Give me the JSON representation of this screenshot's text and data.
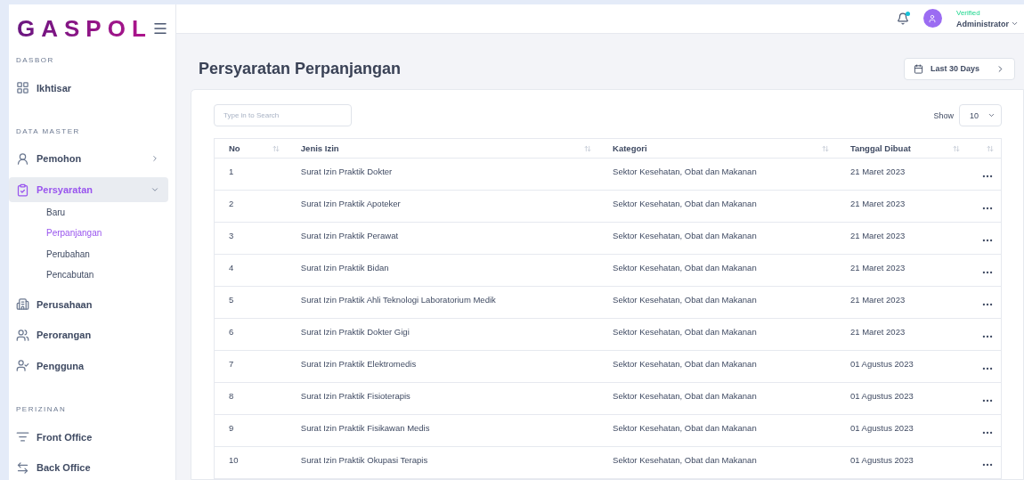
{
  "logo": "GASPOL",
  "sidebar": {
    "sections": [
      {
        "heading": "DASBOR",
        "items": [
          {
            "kind": "grid",
            "label": "Ikhtisar",
            "selected": false
          }
        ]
      },
      {
        "heading": "DATA MASTER",
        "items": [
          {
            "kind": "applicant",
            "label": "Pemohon",
            "selected": false,
            "expanded": false
          },
          {
            "kind": "clipboard",
            "label": "Persyaratan",
            "selected": true,
            "expanded": true,
            "children": [
              {
                "label": "Baru",
                "selected": false
              },
              {
                "label": "Perpanjangan",
                "selected": true
              },
              {
                "label": "Perubahan",
                "selected": false
              },
              {
                "label": "Pencabutan",
                "selected": false
              }
            ]
          },
          {
            "kind": "building",
            "label": "Perusahaan",
            "selected": false
          },
          {
            "kind": "people",
            "label": "Perorangan",
            "selected": false
          },
          {
            "kind": "usercheck",
            "label": "Pengguna",
            "selected": false
          }
        ]
      },
      {
        "heading": "PERIZINAN",
        "items": [
          {
            "kind": "filter",
            "label": "Front Office",
            "selected": false
          },
          {
            "kind": "swap",
            "label": "Back Office",
            "selected": false
          }
        ]
      }
    ]
  },
  "topbar": {
    "notification": true,
    "user": {
      "status": "Verified",
      "name": "Administrator"
    }
  },
  "page": {
    "title": "Persyaratan Perpanjangan",
    "date_range": "Last 30 Days"
  },
  "table": {
    "search": {
      "placeholder": "Type in to Search"
    },
    "show_label": "Show",
    "show_value": "10",
    "columns": [
      "No",
      "Jenis Izin",
      "Kategori",
      "Tanggal Dibuat"
    ],
    "rows": [
      [
        "1",
        "Surat Izin Praktik Dokter",
        "Sektor Kesehatan, Obat dan Makanan",
        "21 Maret 2023"
      ],
      [
        "2",
        "Surat Izin Praktik Apoteker",
        "Sektor Kesehatan, Obat dan Makanan",
        "21 Maret 2023"
      ],
      [
        "3",
        "Surat Izin Praktik Perawat",
        "Sektor Kesehatan, Obat dan Makanan",
        "21 Maret 2023"
      ],
      [
        "4",
        "Surat Izin Praktik Bidan",
        "Sektor Kesehatan, Obat dan Makanan",
        "21 Maret 2023"
      ],
      [
        "5",
        "Surat Izin Praktik Ahli Teknologi Laboratorium Medik",
        "Sektor Kesehatan, Obat dan Makanan",
        "21 Maret 2023"
      ],
      [
        "6",
        "Surat Izin Praktik Dokter Gigi",
        "Sektor Kesehatan, Obat dan Makanan",
        "21 Maret 2023"
      ],
      [
        "7",
        "Surat Izin Praktik Elektromedis",
        "Sektor Kesehatan, Obat dan Makanan",
        "01 Agustus 2023"
      ],
      [
        "8",
        "Surat Izin Praktik Fisioterapis",
        "Sektor Kesehatan, Obat dan Makanan",
        "01 Agustus 2023"
      ],
      [
        "9",
        "Surat Izin Praktik Fisikawan Medis",
        "Sektor Kesehatan, Obat dan Makanan",
        "01 Agustus 2023"
      ],
      [
        "10",
        "Surat Izin Praktik Okupasi Terapis",
        "Sektor Kesehatan, Obat dan Makanan",
        "01 Agustus 2023"
      ]
    ]
  }
}
